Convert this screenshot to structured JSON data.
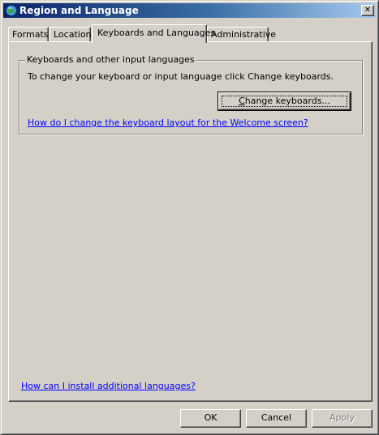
{
  "window": {
    "title": "Region and Language",
    "close_glyph": "✕"
  },
  "tabs": [
    {
      "label": "Formats",
      "active": false
    },
    {
      "label": "Location",
      "active": false
    },
    {
      "label": "Keyboards and Languages",
      "active": true
    },
    {
      "label": "Administrative",
      "active": false
    }
  ],
  "keyboards_group": {
    "title": "Keyboards and other input languages",
    "description": "To change your keyboard or input language click Change keyboards.",
    "change_button": {
      "prefix": "",
      "accel": "C",
      "rest": "hange keyboards..."
    },
    "welcome_link": "How do I change the keyboard layout for the Welcome screen?"
  },
  "install_link": "How can I install additional languages?",
  "buttons": {
    "ok": "OK",
    "cancel": "Cancel",
    "apply": "Apply"
  },
  "colors": {
    "face": "#d4d0c8",
    "title_start": "#0a246a",
    "title_end": "#a6caf0",
    "link": "#0000ff"
  }
}
